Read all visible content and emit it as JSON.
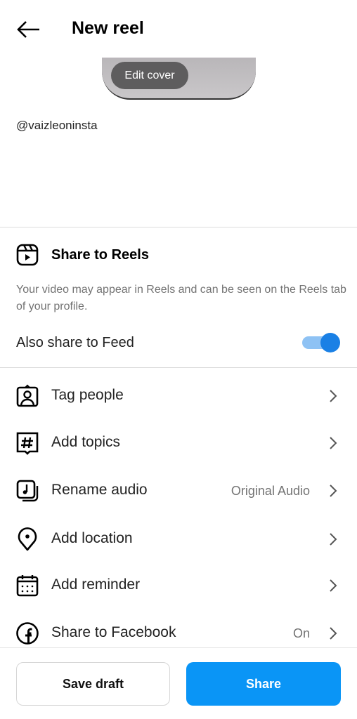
{
  "header": {
    "title": "New reel"
  },
  "cover": {
    "edit_label": "Edit cover"
  },
  "caption": {
    "text": "@vaizleoninsta"
  },
  "reels": {
    "title": "Share to Reels",
    "description": "Your video may appear in Reels and can be seen on the Reels tab of your profile.",
    "feed_label": "Also share to Feed",
    "feed_on": true,
    "accent": "#1a80e5"
  },
  "options": [
    {
      "label": "Tag people",
      "icon": "tag-people-icon",
      "value": ""
    },
    {
      "label": "Add topics",
      "icon": "hashtag-icon",
      "value": ""
    },
    {
      "label": "Rename audio",
      "icon": "audio-icon",
      "value": "Original Audio"
    },
    {
      "label": "Add location",
      "icon": "location-pin-icon",
      "value": ""
    },
    {
      "label": "Add reminder",
      "icon": "calendar-icon",
      "value": ""
    },
    {
      "label": "Share to Facebook",
      "icon": "facebook-icon",
      "value": "On"
    }
  ],
  "footer": {
    "save_label": "Save draft",
    "share_label": "Share",
    "share_color": "#0a95f6"
  }
}
